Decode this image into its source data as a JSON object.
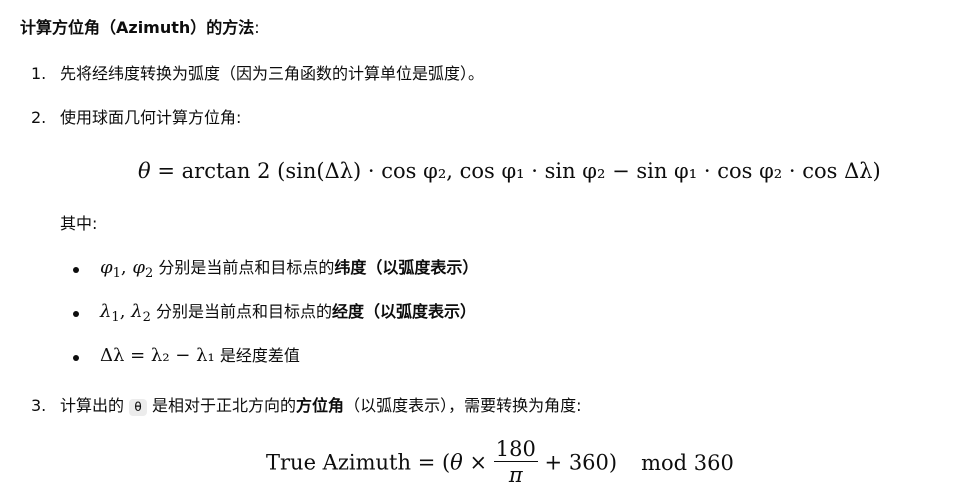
{
  "heading": {
    "title": "计算方位角（Azimuth）的方法",
    "colon": ":"
  },
  "steps": [
    {
      "number": "1.",
      "text": "先将经纬度转换为弧度（因为三角函数的计算单位是弧度）。"
    },
    {
      "number": "2.",
      "text": "使用球面几何计算方位角:"
    },
    {
      "number": "3.",
      "text_before": "计算出的",
      "code": "θ",
      "text_mid": "是相对于正北方向的",
      "bold": "方位角",
      "text_after": "（以弧度表示），需要转换为角度:"
    }
  ],
  "formula_main": {
    "theta": "θ",
    "eq": "=",
    "func": "arctan 2",
    "args": "(sin(Δλ) · cos φ₂, cos φ₁ · sin φ₂ − sin φ₁ · cos φ₂ · cos Δλ)"
  },
  "where_label": "其中:",
  "definitions": [
    {
      "math_a": "φ",
      "sub_a": "1",
      "sep": ", ",
      "math_b": "φ",
      "sub_b": "2",
      "text": "分别是当前点和目标点的",
      "bold": "纬度（以弧度表示）"
    },
    {
      "math_a": "λ",
      "sub_a": "1",
      "sep": ", ",
      "math_b": "λ",
      "sub_b": "2",
      "text": "分别是当前点和目标点的",
      "bold": "经度（以弧度表示）"
    },
    {
      "math": "Δλ = λ₂ − λ₁",
      "text": "是经度差值"
    }
  ],
  "formula_final": {
    "lhs": "True Azimuth = (",
    "theta": "θ",
    "times": " × ",
    "numerator": "180",
    "denominator": "π",
    "rhs": " + 360)",
    "mod": "mod 360"
  }
}
